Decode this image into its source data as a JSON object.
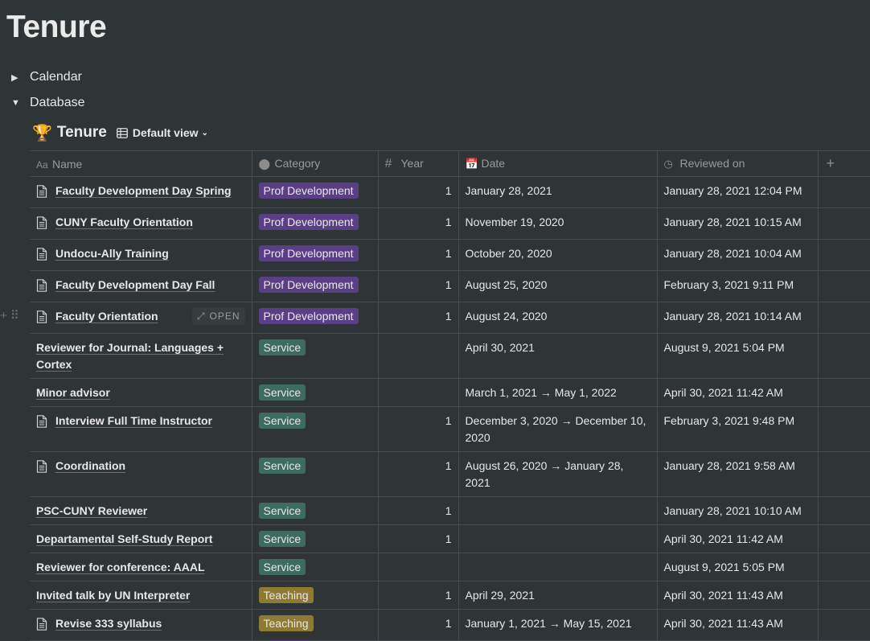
{
  "page": {
    "title": "Tenure"
  },
  "toggles": [
    {
      "label": "Calendar",
      "expanded": false
    },
    {
      "label": "Database",
      "expanded": true
    }
  ],
  "database": {
    "emoji": "🏆",
    "title": "Tenure",
    "view_label": "Default view",
    "columns": {
      "name": "Name",
      "category": "Category",
      "year": "Year",
      "date": "Date",
      "reviewed": "Reviewed on",
      "add": "+"
    },
    "open_label": "OPEN",
    "colors": {
      "Prof Development": "#5a3f86",
      "Service": "#3d6b5f",
      "Teaching": "#8e7a33"
    },
    "rows": [
      {
        "name": "Faculty Development Day Spring",
        "has_icon": true,
        "category": "Prof Development",
        "year": "1",
        "date": "January 28, 2021",
        "reviewed": "January 28, 2021 12:04 PM"
      },
      {
        "name": "CUNY Faculty Orientation",
        "has_icon": true,
        "category": "Prof Development",
        "year": "1",
        "date": "November 19, 2020",
        "reviewed": "January 28, 2021 10:15 AM"
      },
      {
        "name": "Undocu-Ally Training",
        "has_icon": true,
        "category": "Prof Development",
        "year": "1",
        "date": "October 20, 2020",
        "reviewed": "January 28, 2021 10:04 AM"
      },
      {
        "name": "Faculty Development Day Fall",
        "has_icon": true,
        "category": "Prof Development",
        "year": "1",
        "date": "August 25, 2020",
        "reviewed": "February 3, 2021 9:11 PM"
      },
      {
        "name": "Faculty Orientation",
        "has_icon": true,
        "category": "Prof Development",
        "year": "1",
        "date": "August 24, 2020",
        "reviewed": "January 28, 2021 10:14 AM",
        "hover": true
      },
      {
        "name": "Reviewer for Journal: Languages + Cortex",
        "has_icon": false,
        "category": "Service",
        "year": "",
        "date": "April 30, 2021",
        "reviewed": "August 9, 2021 5:04 PM"
      },
      {
        "name": "Minor advisor",
        "has_icon": false,
        "category": "Service",
        "year": "",
        "date": "March 1, 2021 → May 1, 2022",
        "reviewed": "April 30, 2021 11:42 AM"
      },
      {
        "name": "Interview Full Time Instructor",
        "has_icon": true,
        "category": "Service",
        "year": "1",
        "date": "December 3, 2020 → December 10, 2020",
        "reviewed": "February 3, 2021 9:48 PM"
      },
      {
        "name": "Coordination",
        "has_icon": true,
        "category": "Service",
        "year": "1",
        "date": "August 26, 2020 → January 28, 2021",
        "reviewed": "January 28, 2021 9:58 AM"
      },
      {
        "name": "PSC-CUNY Reviewer",
        "has_icon": false,
        "category": "Service",
        "year": "1",
        "date": "",
        "reviewed": "January 28, 2021 10:10 AM"
      },
      {
        "name": "Departamental Self-Study Report",
        "has_icon": false,
        "category": "Service",
        "year": "1",
        "date": "",
        "reviewed": "April 30, 2021 11:42 AM"
      },
      {
        "name": "Reviewer for conference: AAAL",
        "has_icon": false,
        "category": "Service",
        "year": "",
        "date": "",
        "reviewed": "August 9, 2021 5:05 PM"
      },
      {
        "name": "Invited talk by UN Interpreter",
        "has_icon": false,
        "category": "Teaching",
        "year": "1",
        "date": "April 29, 2021",
        "reviewed": "April 30, 2021 11:43 AM"
      },
      {
        "name": "Revise 333 syllabus",
        "has_icon": true,
        "category": "Teaching",
        "year": "1",
        "date": "January 1, 2021 → May 15, 2021",
        "reviewed": "April 30, 2021 11:43 AM"
      }
    ]
  }
}
